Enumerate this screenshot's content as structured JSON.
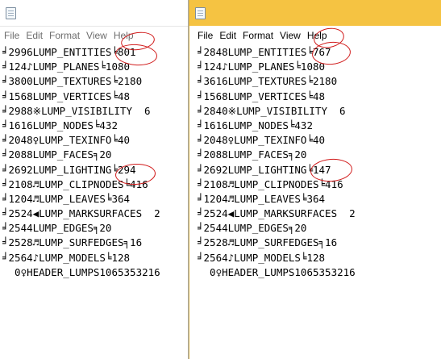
{
  "menu": {
    "items": [
      {
        "label": "File"
      },
      {
        "label": "Edit"
      },
      {
        "label": "Format"
      },
      {
        "label": "View"
      },
      {
        "label": "Help"
      }
    ]
  },
  "left": {
    "lines": [
      {
        "text": "╛2996LUMP_ENTITIES╘801"
      },
      {
        "text": "╛124♪LUMP_PLANES╘1080"
      },
      {
        "text": "╛3800LUMP_TEXTURES╘2180"
      },
      {
        "text": "╛1568LUMP_VERTICES╘48"
      },
      {
        "text": "╛2988※LUMP_VISIBILITY  6"
      },
      {
        "text": "╛1616LUMP_NODES╘432"
      },
      {
        "text": "╛2048♀LUMP_TEXINFO╘40"
      },
      {
        "text": "╛2088LUMP_FACES╕20"
      },
      {
        "text": "╛2692LUMP_LIGHTING╘294"
      },
      {
        "text": "╛2108♬LUMP_CLIPNODES╘416"
      },
      {
        "text": "╛1204♬LUMP_LEAVES╘364"
      },
      {
        "text": "╛2524◀LUMP_MARKSURFACES  2"
      },
      {
        "text": "╛2544LUMP_EDGES╕20"
      },
      {
        "text": "╛2528♬LUMP_SURFEDGES╕16"
      },
      {
        "text": "╛2564♪LUMP_MODELS╘128"
      },
      {
        "text": "  0♀HEADER_LUMPS1065353216"
      }
    ]
  },
  "right": {
    "lines": [
      {
        "text": "╛2848LUMP_ENTITIES╘767"
      },
      {
        "text": "╛124♪LUMP_PLANES╘1080"
      },
      {
        "text": "╛3616LUMP_TEXTURES╘2180"
      },
      {
        "text": "╛1568LUMP_VERTICES╘48"
      },
      {
        "text": "╛2840※LUMP_VISIBILITY  6"
      },
      {
        "text": "╛1616LUMP_NODES╘432"
      },
      {
        "text": "╛2048♀LUMP_TEXINFO╘40"
      },
      {
        "text": "╛2088LUMP_FACES╕20"
      },
      {
        "text": "╛2692LUMP_LIGHTING╘147"
      },
      {
        "text": "╛2108♬LUMP_CLIPNODES╘416"
      },
      {
        "text": "╛1204♬LUMP_LEAVES╘364"
      },
      {
        "text": "╛2524◀LUMP_MARKSURFACES  2"
      },
      {
        "text": "╛2544LUMP_EDGES╕20"
      },
      {
        "text": "╛2528♬LUMP_SURFEDGES╕16"
      },
      {
        "text": "╛2564♪LUMP_MODELS╘128"
      },
      {
        "text": "  0♀HEADER_LUMPS1065353216"
      }
    ]
  },
  "annotations": {
    "color": "#d11b1b"
  },
  "colors": {
    "active_titlebar": "#f5c342",
    "inactive_titlebar": "#ffffff"
  },
  "icons": {
    "window": "notepad-icon"
  }
}
